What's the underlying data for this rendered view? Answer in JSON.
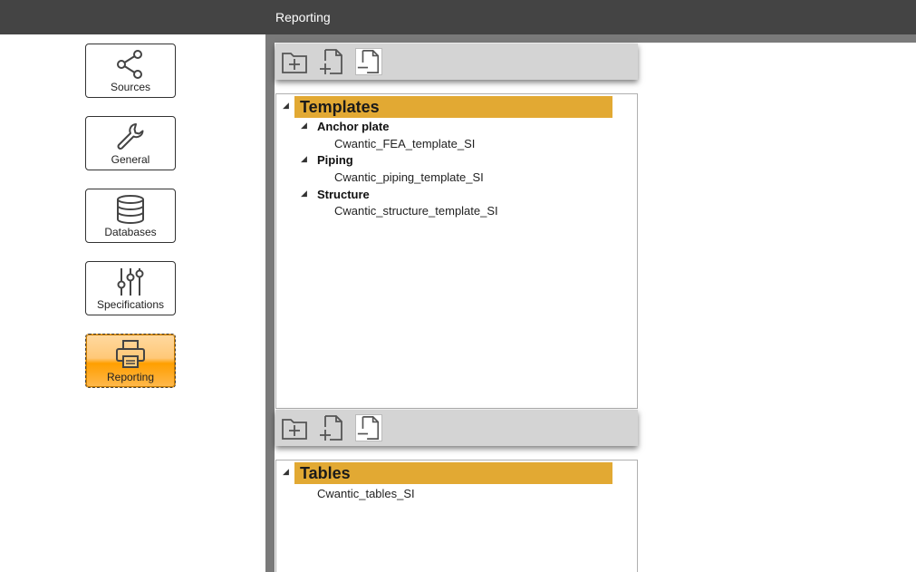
{
  "window": {
    "title": "Reporting"
  },
  "sidebar": {
    "items": [
      {
        "label": "Sources",
        "icon": "share-icon"
      },
      {
        "label": "General",
        "icon": "wrench-icon"
      },
      {
        "label": "Databases",
        "icon": "database-icon"
      },
      {
        "label": "Specifications",
        "icon": "sliders-icon"
      },
      {
        "label": "Reporting",
        "icon": "printer-icon",
        "active": true
      }
    ]
  },
  "templates_panel": {
    "toolbar": [
      "add-folder-icon",
      "add-file-icon",
      "remove-file-icon"
    ],
    "root": "Templates",
    "groups": [
      {
        "name": "Anchor plate",
        "items": [
          "Cwantic_FEA_template_SI"
        ]
      },
      {
        "name": "Piping",
        "items": [
          "Cwantic_piping_template_SI"
        ]
      },
      {
        "name": "Structure",
        "items": [
          "Cwantic_structure_template_SI"
        ]
      }
    ]
  },
  "tables_panel": {
    "toolbar": [
      "add-folder-icon",
      "add-file-icon",
      "remove-file-icon"
    ],
    "root": "Tables",
    "items": [
      "Cwantic_tables_SI"
    ]
  },
  "colors": {
    "titlebar": "#444444",
    "header_accent": "#e2a933",
    "active_button": "#ffa500",
    "divider": "#7a7a7a"
  }
}
